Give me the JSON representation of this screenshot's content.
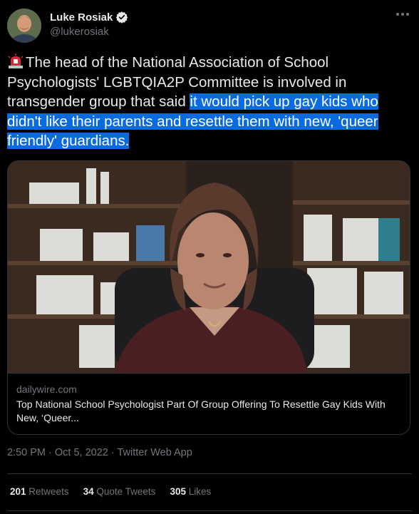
{
  "author": {
    "name": "Luke Rosiak",
    "handle": "@lukerosiak"
  },
  "tweet": {
    "emoji": "rotating-light",
    "text_plain": "The head of the National Association of School Psychologists' LGBTQIA2P Committee is involved in transgender group that said ",
    "text_highlighted": "it would pick up gay kids who didn't like their parents and resettle them with new, 'queer friendly' guardians."
  },
  "card": {
    "domain": "dailywire.com",
    "title": "Top National School Psychologist Part Of Group Offering To Resettle Gay Kids With New, ‘Queer..."
  },
  "meta": {
    "timestamp": "2:50 PM · Oct 5, 2022 · Twitter Web App"
  },
  "stats": [
    {
      "count": "201",
      "label": "Retweets"
    },
    {
      "count": "34",
      "label": "Quote Tweets"
    },
    {
      "count": "305",
      "label": "Likes"
    }
  ],
  "colors": {
    "background": "#000000",
    "text": "#e7e9ea",
    "muted": "#71767b",
    "highlight": "#0a6be0",
    "verified": "#1d9bf0"
  }
}
